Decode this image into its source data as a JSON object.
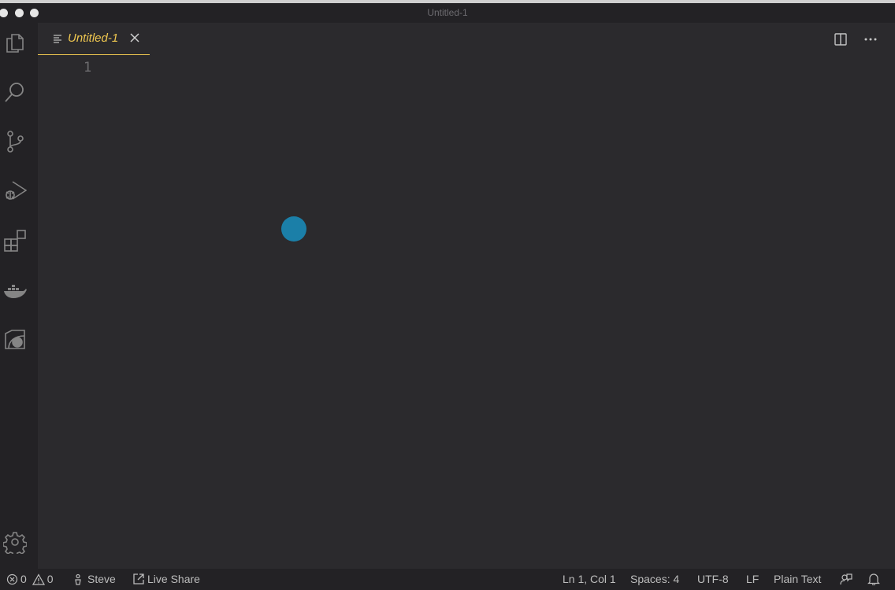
{
  "window": {
    "title": "Untitled-1"
  },
  "activity_bar": {
    "items": [
      "explorer-icon",
      "search-icon",
      "source-control-icon",
      "run-debug-icon",
      "extensions-icon",
      "docker-icon",
      "remote-explorer-icon"
    ],
    "bottom": "gear-icon"
  },
  "tabs": [
    {
      "label": "Untitled-1",
      "active": true,
      "color": "#f0c850"
    }
  ],
  "editor": {
    "line_numbers": [
      "1"
    ],
    "cursor_highlight_color": "#1b7fa8"
  },
  "status_bar": {
    "errors": "0",
    "warnings": "0",
    "user": "Steve",
    "live_share": "Live Share",
    "position": "Ln 1, Col 1",
    "spaces": "Spaces: 4",
    "encoding": "UTF-8",
    "eol": "LF",
    "language": "Plain Text"
  }
}
